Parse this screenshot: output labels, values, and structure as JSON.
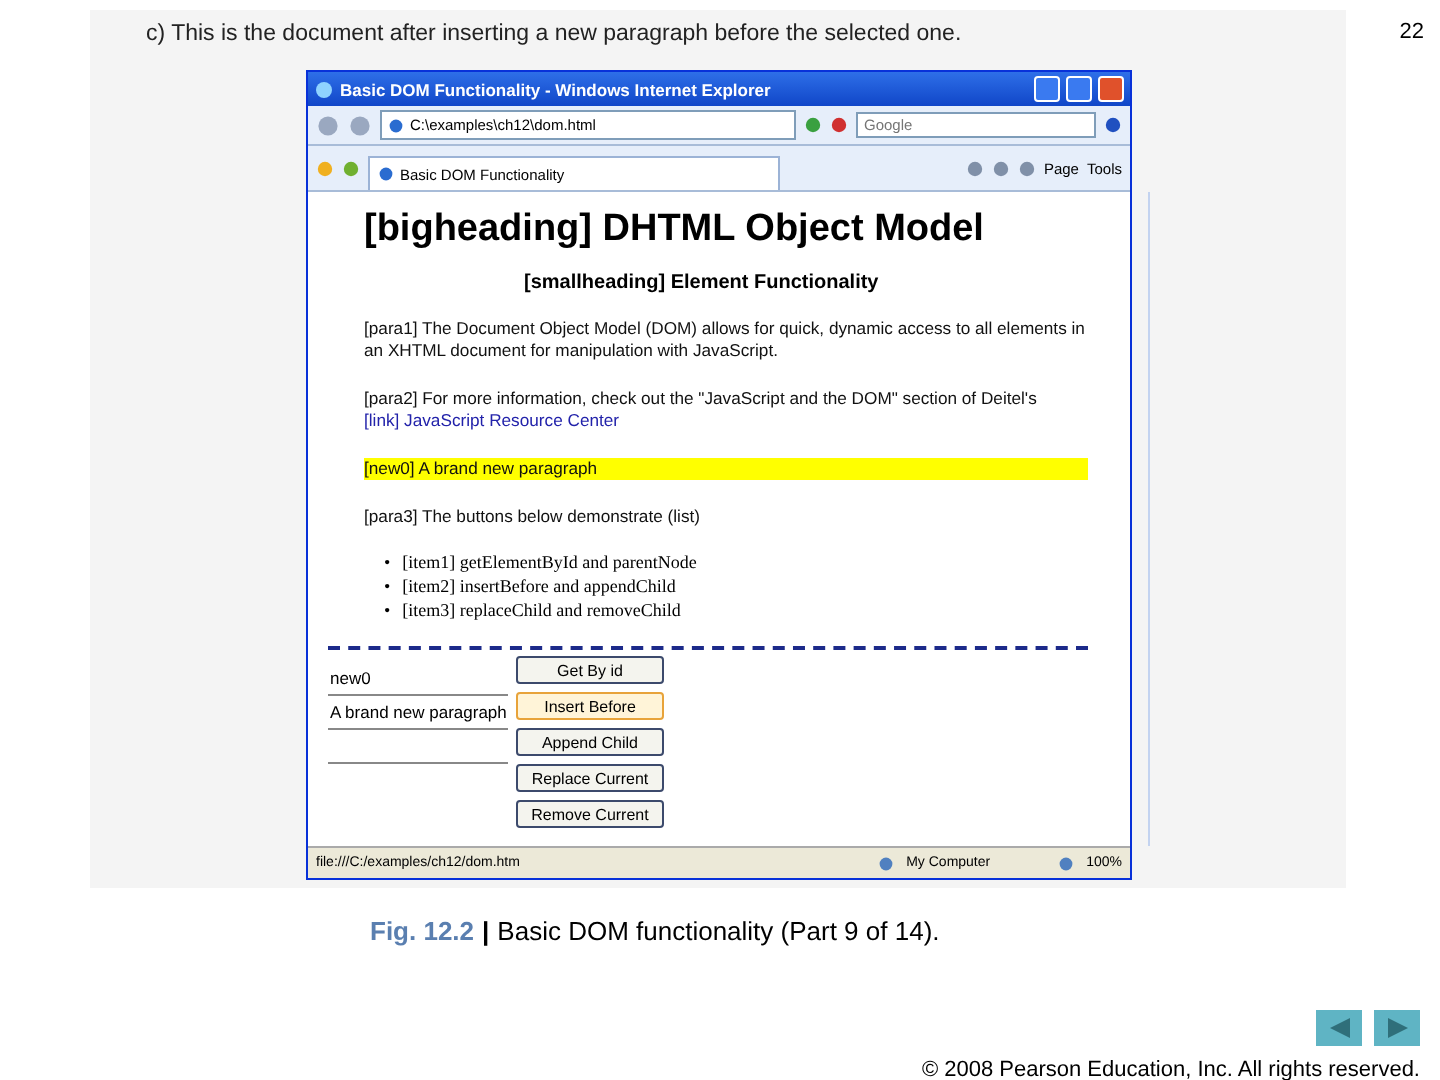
{
  "page_number": "22",
  "panel": {
    "caption": "c) This is the document after inserting a new paragraph before the selected one."
  },
  "browser": {
    "title": "Basic DOM Functionality - Windows Internet Explorer",
    "address": "C:\\examples\\ch12\\dom.html",
    "search": {
      "placeholder": "Google"
    },
    "tab": "Basic DOM Functionality",
    "toolbar": [
      "Page",
      "Tools"
    ],
    "content": {
      "big_heading": "[bigheading] DHTML Object Model",
      "small_heading": "[smallheading] Element Functionality",
      "paragraphs": [
        {
          "text": "[para1] The Document Object Model (DOM) allows for quick, dynamic access to all elements in an XHTML document for manipulation with JavaScript.",
          "highlighted": false
        },
        {
          "text": "[para2] For more information, check out the \"JavaScript and the DOM\" section of Deitel's",
          "link": "[link] JavaScript Resource Center",
          "highlighted": false
        },
        {
          "text": "[new0] A brand new paragraph",
          "highlighted": true
        },
        {
          "text": "[para3] The buttons below demonstrate (list)",
          "highlighted": false
        }
      ],
      "list": [
        {
          "bullet": "•",
          "text": "[item1] getElementById and parentNode"
        },
        {
          "bullet": "•",
          "text": "[item2] insertBefore and appendChild"
        },
        {
          "bullet": "•",
          "text": "[item3] replaceChild and removeChild"
        }
      ],
      "fields": [
        {
          "kind": "filled",
          "value": "new0"
        },
        {
          "kind": "filled",
          "value": "A brand new paragraph"
        },
        {
          "kind": "blank"
        }
      ],
      "buttons": [
        {
          "label": "Get By id",
          "hovered": false
        },
        {
          "label": "Insert Before",
          "hovered": true
        },
        {
          "label": "Append Child",
          "hovered": false
        },
        {
          "label": "Replace Current",
          "hovered": false
        },
        {
          "label": "Remove Current",
          "hovered": false
        }
      ]
    },
    "status": {
      "text": "file:///C:/examples/ch12/dom.htm",
      "zone": "My Computer",
      "zoom": "100%"
    }
  },
  "figure_caption": {
    "label": "Fig. 12.2",
    "separator": "|",
    "text": "Basic DOM functionality (Part 9 of 14)."
  },
  "copyright": "© 2008 Pearson Education, Inc.  All rights reserved."
}
